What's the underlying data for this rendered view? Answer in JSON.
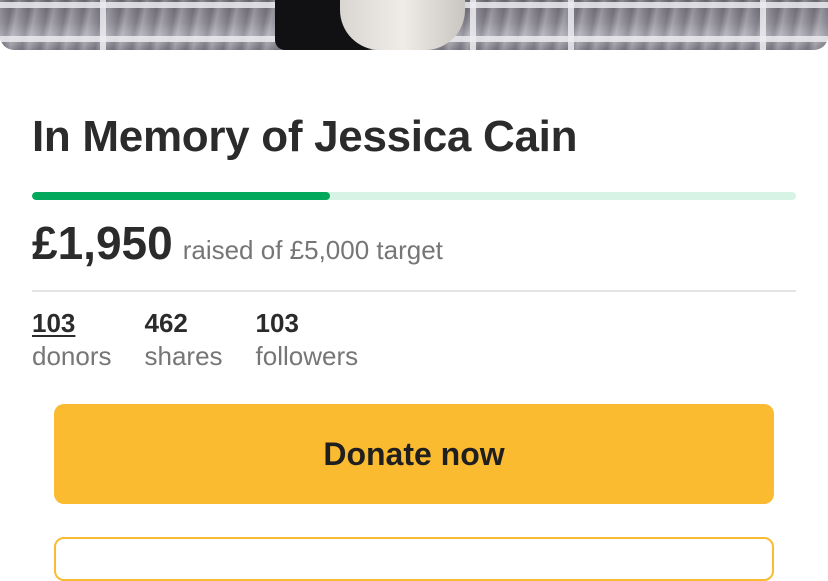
{
  "campaign": {
    "title": "In Memory of Jessica Cain",
    "progress_fraction": 0.39
  },
  "funding": {
    "raised": "£1,950",
    "raised_label": "raised of £5,000 target"
  },
  "stats": [
    {
      "value": "103",
      "label": "donors"
    },
    {
      "value": "462",
      "label": "shares"
    },
    {
      "value": "103",
      "label": "followers"
    }
  ],
  "actions": {
    "donate_label": "Donate now"
  },
  "colors": {
    "progress_fill": "#02a95c",
    "progress_track": "#d6f3e6",
    "donate_button": "#fbbb31"
  }
}
